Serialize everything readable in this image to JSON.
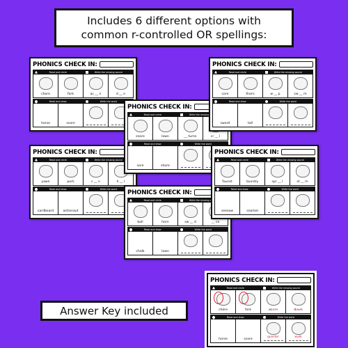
{
  "title": {
    "line1": "Includes 6 different options with",
    "line2": "common r-controlled OR spellings:"
  },
  "answer_key_label": "Answer Key included",
  "colors": {
    "background": "#7a2ff0",
    "answer_red": "#e0213a"
  },
  "worksheet_labels": {
    "title": "PHONICS CHECK IN:",
    "read_circle": "Read and circle",
    "missing_sound": "Write the missing sound",
    "read_draw": "Read and draw",
    "write_word": "Write the word"
  },
  "worksheets": [
    {
      "id": "ws1",
      "top": [
        "chore",
        "fork",
        "ac __ n",
        "d __ n"
      ],
      "bottom": [
        "horse",
        "score",
        "",
        ""
      ]
    },
    {
      "id": "ws4",
      "top": [
        "yawn",
        "pork",
        "c __ n",
        "h __ l"
      ],
      "bottom": [
        "cardboard",
        "astronaut",
        "",
        ""
      ]
    },
    {
      "id": "ws3",
      "top": [
        "snore",
        "lawn",
        "__ tumn",
        "cr __ l"
      ],
      "bottom": [
        "sore",
        "shore",
        "",
        ""
      ]
    },
    {
      "id": "ws6",
      "top": [
        "ball",
        "horn",
        "sw __ d",
        "__ ca"
      ],
      "bottom": [
        "chalk",
        "lawn",
        "",
        ""
      ]
    },
    {
      "id": "ws2",
      "top": [
        "core",
        "thorn",
        "w __ p",
        "sw __ m"
      ],
      "bottom": [
        "sword",
        "tall",
        "",
        ""
      ]
    },
    {
      "id": "ws5",
      "top": [
        "faucet",
        "laundry",
        "spr __ l",
        "st __ m"
      ],
      "bottom": [
        "seesaw",
        "snorkel",
        "",
        ""
      ]
    }
  ],
  "answer_key": {
    "top": [
      "chore",
      "fork",
      "ac or n",
      "d aw n"
    ],
    "bottom": [
      "horse",
      "score",
      "quarter",
      "walk"
    ],
    "circled": [
      "chore",
      "fork"
    ]
  }
}
